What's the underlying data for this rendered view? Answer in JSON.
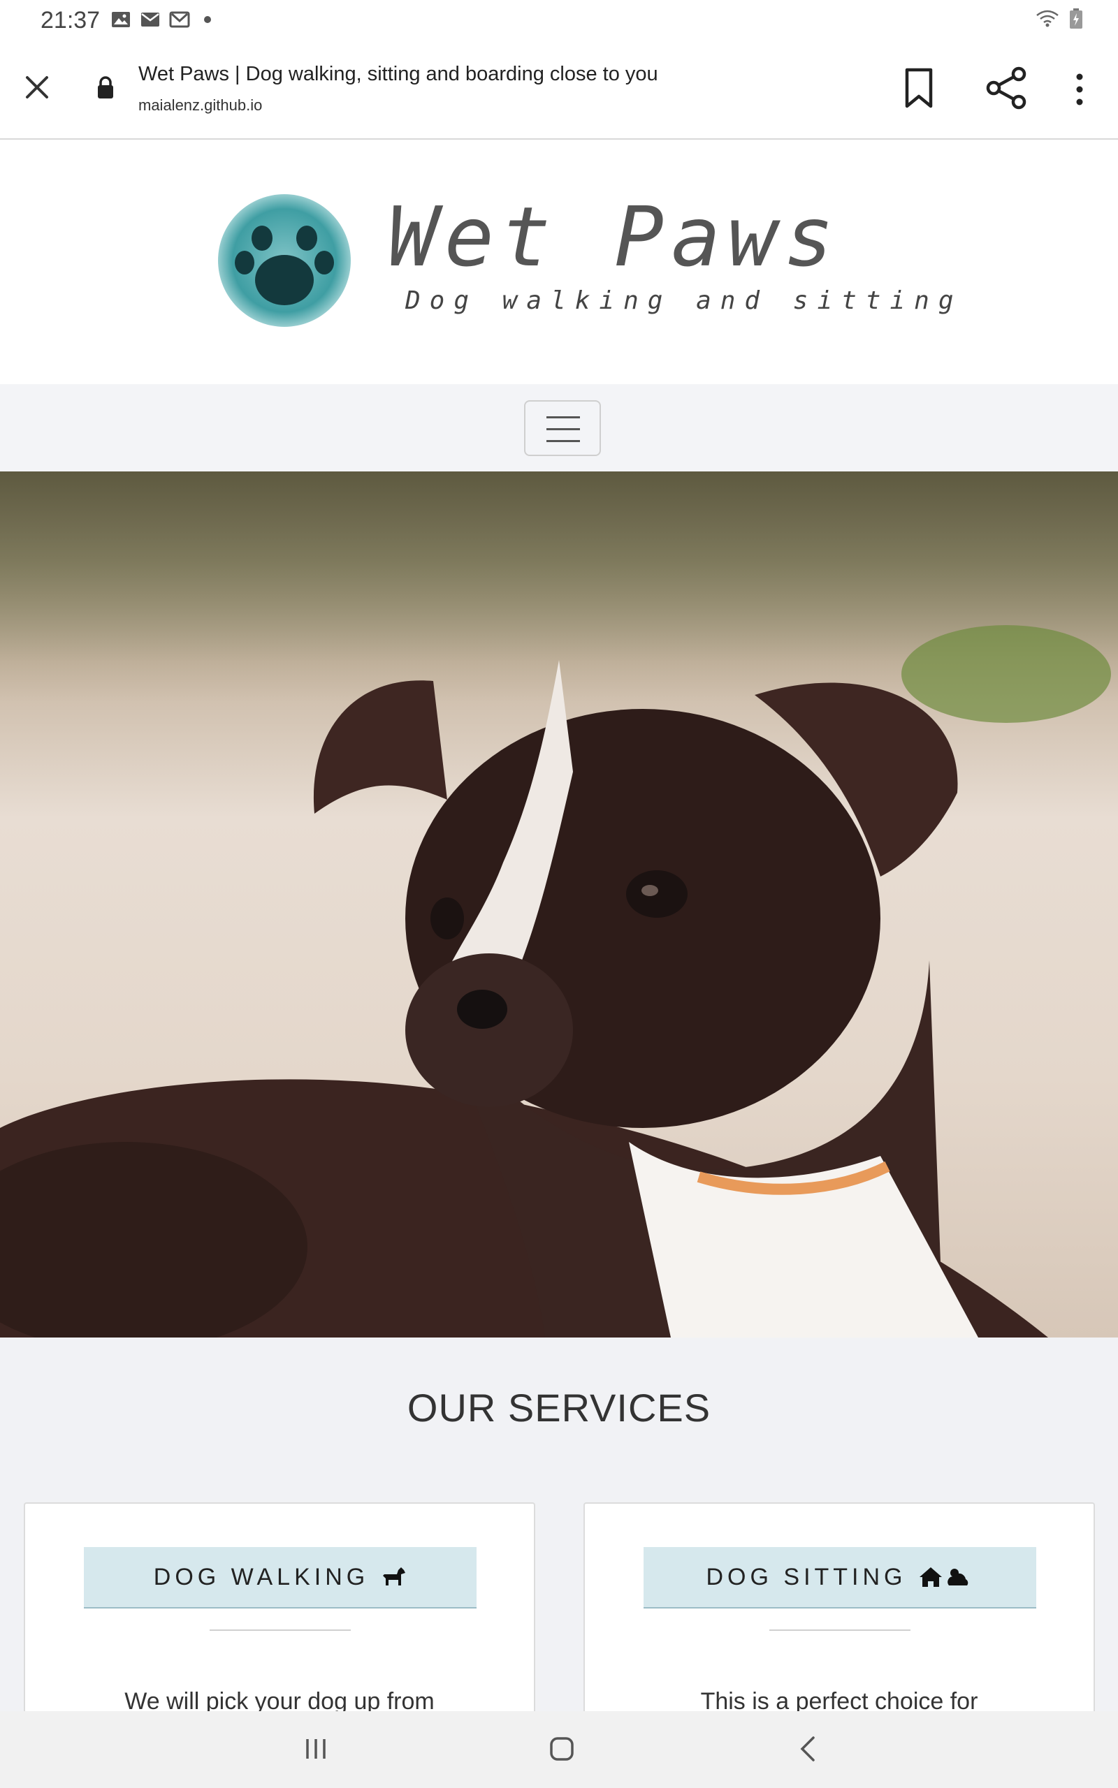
{
  "status_bar": {
    "time": "21:37",
    "icons": [
      "image-icon",
      "mail-icon",
      "gmail-icon",
      "notification-dot",
      "wifi-icon",
      "battery-icon"
    ]
  },
  "browser": {
    "page_title": "Wet Paws | Dog walking, sitting and boarding close to you",
    "url": "maialenz.github.io",
    "icons": [
      "close-icon",
      "lock-icon",
      "bookmark-icon",
      "share-icon",
      "more-vert-icon"
    ]
  },
  "header": {
    "brand": "Wet Paws",
    "tagline": "Dog walking and sitting",
    "logo_icon": "paw-icon",
    "accent": "#3f9ea3"
  },
  "nav": {
    "toggle_icon": "hamburger-icon"
  },
  "hero": {
    "image": "puppy on beach photo"
  },
  "services": {
    "title": "OUR SERVICES",
    "cards": [
      {
        "label": "DOG WALKING",
        "icon": "dog-icon",
        "description": "We will pick your dog up from"
      },
      {
        "label": "DOG SITTING",
        "icon": "house-cloud-sun-icon",
        "description": "This is a perfect choice for"
      }
    ],
    "label_bg": "#d6e8ed"
  },
  "system_nav": {
    "icons": [
      "recents-icon",
      "home-icon",
      "back-icon"
    ]
  }
}
